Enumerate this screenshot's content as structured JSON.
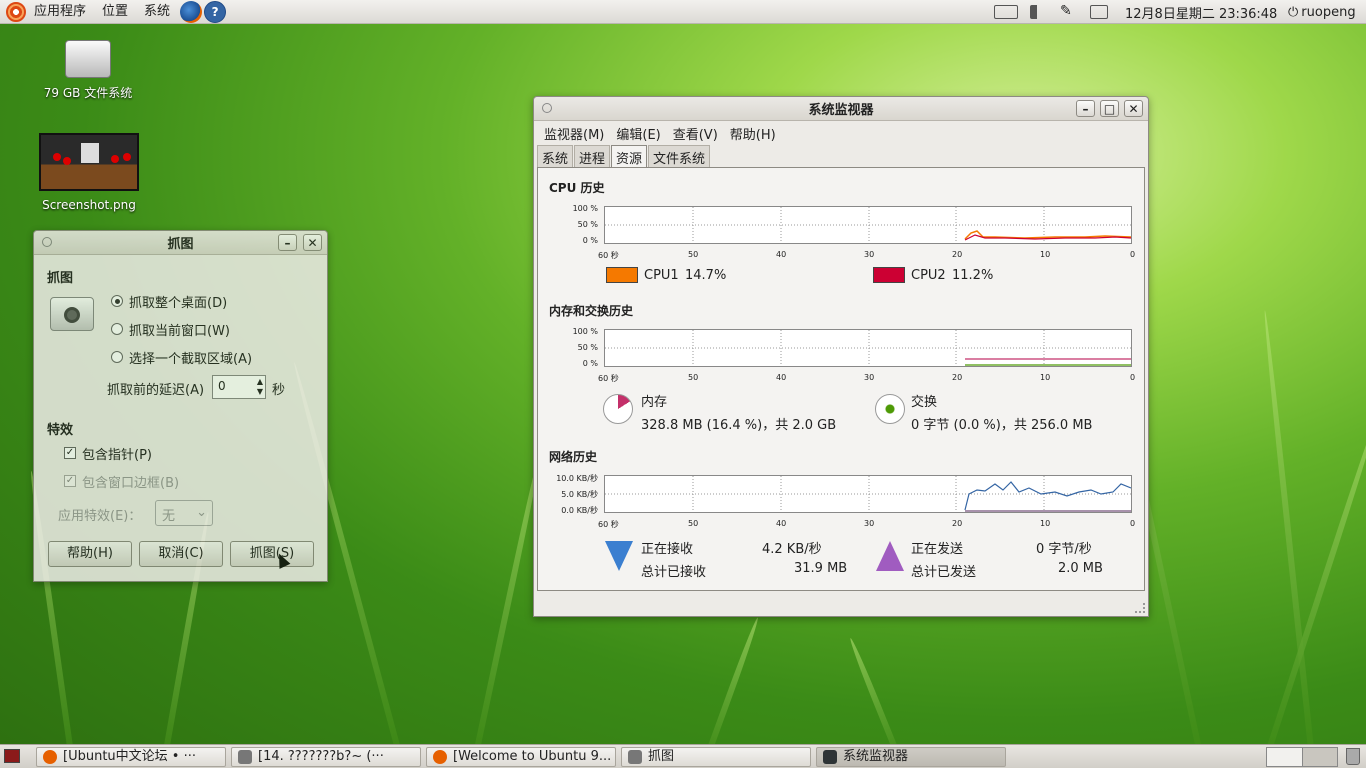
{
  "top_panel": {
    "menus": [
      "应用程序",
      "位置",
      "系统"
    ],
    "datetime": "12月8日星期二 23:36:48",
    "user": "ruopeng",
    "launchers": [
      "firefox-icon",
      "help-icon"
    ]
  },
  "desktop": {
    "icons": [
      {
        "label": "79 GB 文件系统",
        "icon": "drive-icon"
      },
      {
        "label": "Screenshot.png",
        "icon": "image-thumbnail"
      }
    ]
  },
  "sysmon": {
    "title": "系统监视器",
    "menu": [
      "监视器(M)",
      "编辑(E)",
      "查看(V)",
      "帮助(H)"
    ],
    "tabs": [
      "系统",
      "进程",
      "资源",
      "文件系统"
    ],
    "active_tab": "资源",
    "cpu": {
      "heading": "CPU 历史",
      "y_labels": [
        "100 %",
        "50 %",
        "0 %"
      ],
      "x_labels": [
        "60 秒",
        "50",
        "40",
        "30",
        "20",
        "10",
        "0"
      ],
      "series": [
        {
          "name": "CPU1",
          "value": "14.7%",
          "color": "#f57900"
        },
        {
          "name": "CPU2",
          "value": "11.2%",
          "color": "#cc0033"
        }
      ]
    },
    "memory": {
      "heading": "内存和交换历史",
      "y_labels": [
        "100 %",
        "50 %",
        "0 %"
      ],
      "mem_label": "内存",
      "mem_value": "328.8 MB (16.4 %)，共 2.0 GB",
      "swap_label": "交换",
      "swap_value": "0 字节 (0.0 %)，共 256.0 MB"
    },
    "network": {
      "heading": "网络历史",
      "y_labels": [
        "10.0 KB/秒",
        "5.0 KB/秒",
        "0.0 KB/秒"
      ],
      "recv_label": "正在接收",
      "recv_rate": "4.2 KB/秒",
      "recv_total_label": "总计已接收",
      "recv_total": "31.9 MB",
      "send_label": "正在发送",
      "send_rate": "0 字节/秒",
      "send_total_label": "总计已发送",
      "send_total": "2.0 MB"
    }
  },
  "screenshot_dialog": {
    "title": "抓图",
    "heading": "抓图",
    "options": [
      "抓取整个桌面(D)",
      "抓取当前窗口(W)",
      "选择一个截取区域(A)"
    ],
    "selected_option": 0,
    "delay_label": "抓取前的延迟(A)",
    "delay_value": "0",
    "delay_unit": "秒",
    "effects_heading": "特效",
    "include_pointer": "包含指针(P)",
    "include_border": "包含窗口边框(B)",
    "apply_effect_label": "应用特效(E)：",
    "apply_effect_value": "无",
    "buttons": [
      "帮助(H)",
      "取消(C)",
      "抓图(S)"
    ]
  },
  "taskbar": {
    "tasks": [
      {
        "label": "[Ubuntu中文论坛 • ···",
        "active": false
      },
      {
        "label": "[14. ???????b?~  (···",
        "active": false
      },
      {
        "label": "[Welcome to Ubuntu 9...",
        "active": false
      },
      {
        "label": "抓图",
        "active": false
      },
      {
        "label": "系统监视器",
        "active": true
      }
    ]
  }
}
